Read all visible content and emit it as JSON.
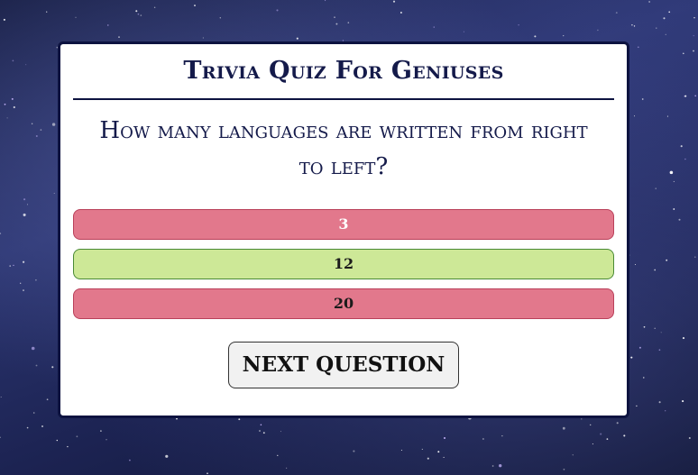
{
  "quiz": {
    "title": "Trivia Quiz For Geniuses",
    "question": "How many languages are written from right to left?",
    "answers": [
      {
        "label": "3",
        "state": "wrong-selected"
      },
      {
        "label": "12",
        "state": "correct"
      },
      {
        "label": "20",
        "state": "wrong"
      }
    ],
    "next_label": "NEXT QUESTION"
  },
  "colors": {
    "card_border": "#0d1340",
    "text": "#141a4a",
    "wrong_answer": "#e2788c",
    "correct_answer": "#cde897",
    "button_bg": "#f1f1f1"
  }
}
